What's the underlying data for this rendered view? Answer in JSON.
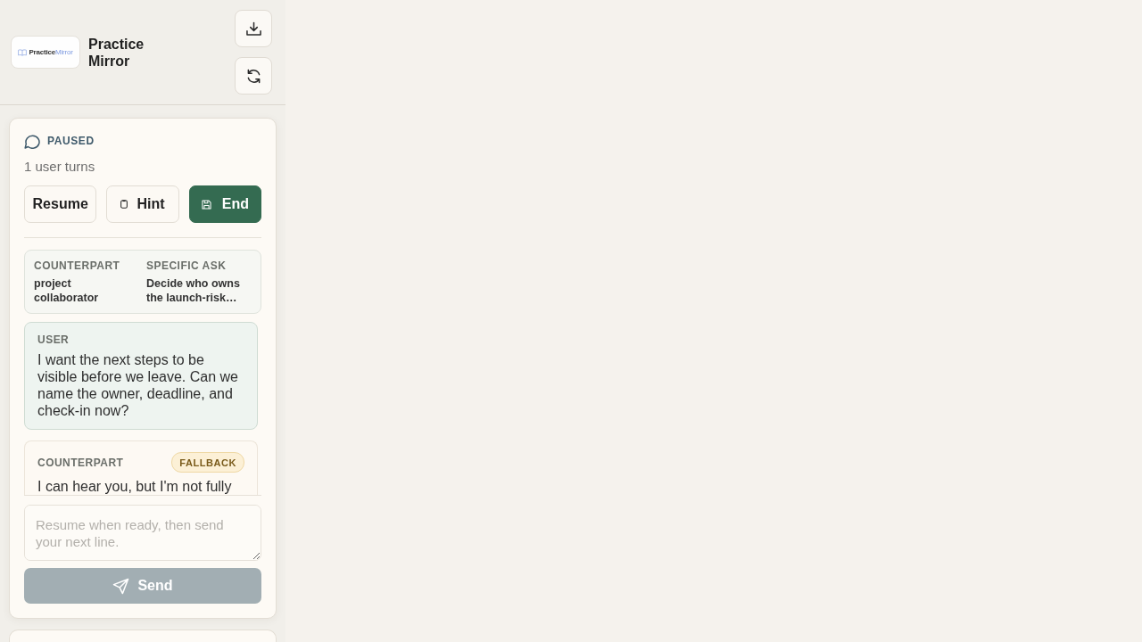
{
  "sidebar": {
    "logo": {
      "brand": "Practice",
      "accent": "Mirror"
    },
    "title": "Practice Mirror",
    "session": {
      "status": "PAUSED",
      "turns": "1 user turns",
      "actions": [
        {
          "label": "Resume",
          "kind": "plain"
        },
        {
          "label": "Hint",
          "kind": "hint"
        },
        {
          "label": "End",
          "kind": "end"
        }
      ],
      "context": [
        {
          "label": "COUNTERPART",
          "value": "project collaborator"
        },
        {
          "label": "SPECIFIC ASK",
          "value": "Decide who owns the launch-risk…"
        }
      ],
      "messages": [
        {
          "kind": "user",
          "speaker": "USER",
          "text": "I want the next steps to be visible before we leave. Can we name the owner, deadline, and check-in now?"
        },
        {
          "kind": "counterpart",
          "speaker": "COUNTERPART",
          "badge": "FALLBACK",
          "text": "I can hear you, but I'm not fully"
        }
      ],
      "composer": {
        "placeholder": "Resume when ready, then send your next line.",
        "send": {
          "label": "Send",
          "disabled": true
        }
      }
    }
  }
}
